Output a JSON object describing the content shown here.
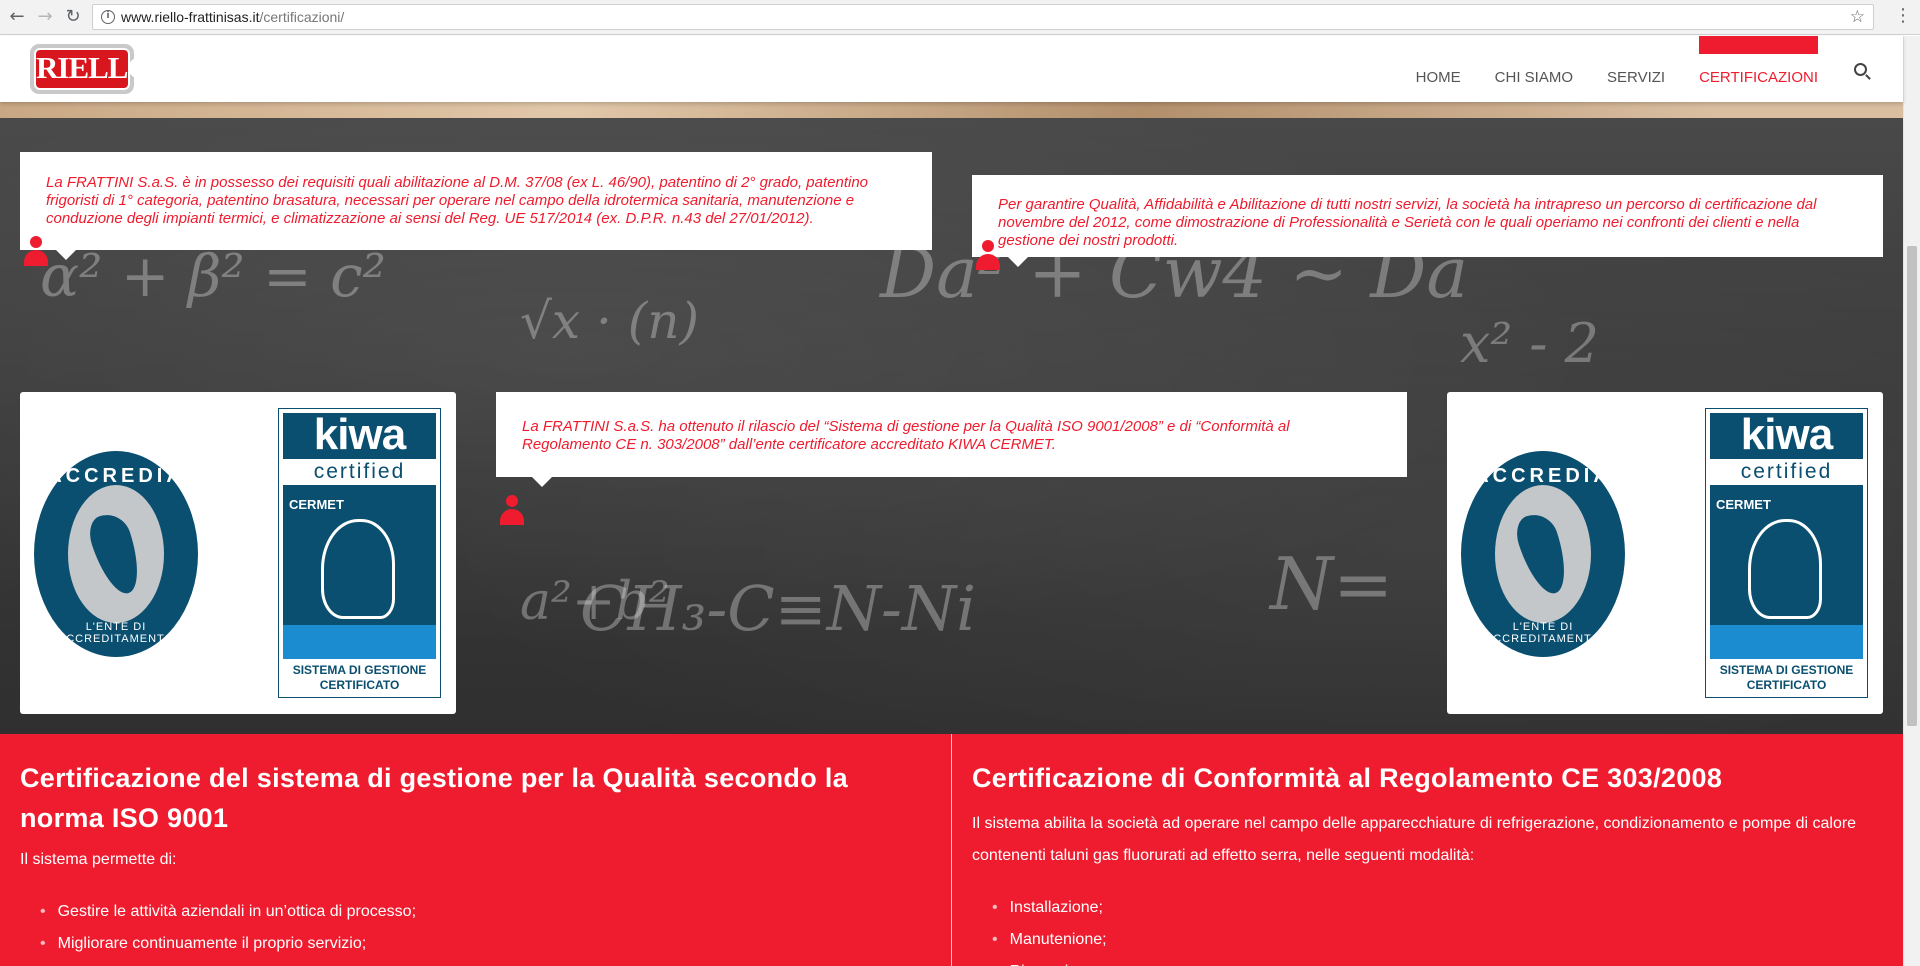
{
  "browser": {
    "url_host": "www.riello-frattinisas.it",
    "url_path": "/certificazioni/"
  },
  "site": {
    "logo_text": "RIELLO",
    "nav": [
      {
        "label": "HOME",
        "active": false
      },
      {
        "label": "CHI SIAMO",
        "active": false
      },
      {
        "label": "SERVIZI",
        "active": false
      },
      {
        "label": "CERTIFICAZIONI",
        "active": true
      }
    ]
  },
  "hero": {
    "bubble1": "La FRATTINI S.a.S. è in possesso dei requisiti quali abilitazione al D.M. 37/08 (ex L. 46/90), patentino di 2° grado, patentino frigoristi di 1° categoria, patentino brasatura, necessari per operare nel campo della idrotermica sanitaria, manutenzione e conduzione degli impianti termici, e climatizzazione ai sensi del Reg. UE 517/2014 (ex. D.P.R. n.43 del 27/01/2012).",
    "bubble2": "Per garantire Qualità, Affidabilità e Abilitazione di tutti nostri servizi, la società ha intrapreso un percorso di certificazione dal novembre del 2012, come dimostrazione di Professionalità e Serietà con le quali operiamo nei confronti dei clienti e nella gestione dei nostri prodotti.",
    "bubble3": "La FRATTINI S.a.S. ha ottenuto il rilascio del “Sistema di gestione per la Qualità ISO 9001/2008” e di “Conformità al Regolamento CE n. 303/2008” dall’ente certificatore accreditato KIWA CERMET.",
    "accredia_word": "ACCREDIA",
    "accredia_sub": "L'ENTE DI ACCREDITAMENTO",
    "kiwa_word": "kiwa",
    "kiwa_certified": "certified",
    "kiwa_cermet": "CERMET",
    "kiwa_text": "SISTEMA DI GESTIONE CERTIFICATO"
  },
  "panel_left": {
    "title": "Certificazione del sistema di gestione per la Qualità secondo la norma ISO 9001",
    "intro": "Il sistema permette di:",
    "items": [
      "Gestire le attività aziendali in un’ottica di processo;",
      "Migliorare continuamente il proprio servizio;"
    ]
  },
  "panel_right": {
    "title": "Certificazione di Conformità al Regolamento CE 303/2008",
    "intro": "Il sistema abilita la società ad operare nel campo delle apparecchiature di refrigerazione, condizionamento e pompe di calore contenenti taluni gas fluorurati ad effetto serra, nelle seguenti modalità:",
    "items": [
      "Installazione;",
      "Manutenione;",
      "Riparazione;"
    ]
  },
  "colors": {
    "accent": "#ee1c2e",
    "accredia_blue": "#0b4f70",
    "kiwa_water": "#1b8ccf"
  }
}
